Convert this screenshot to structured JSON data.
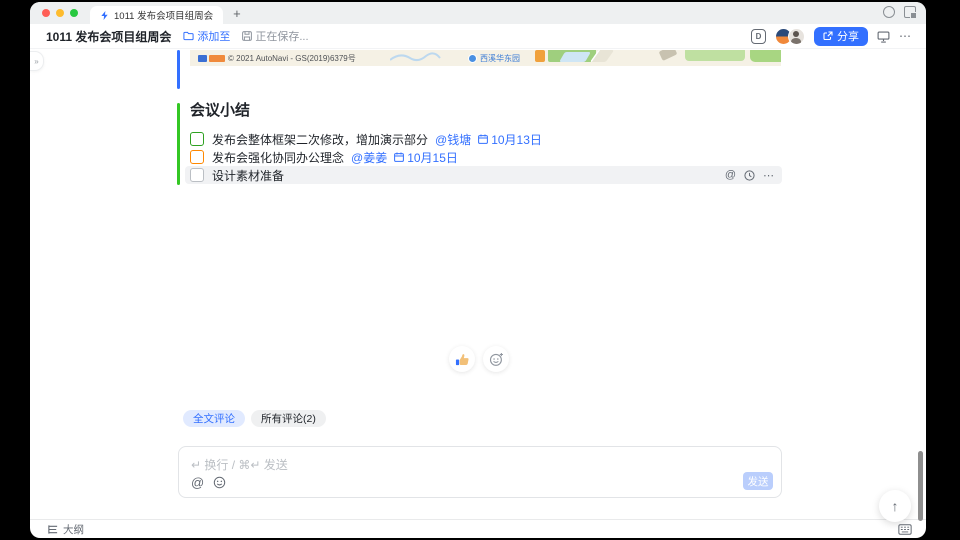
{
  "chrome": {
    "tab_title": "1011 发布会项目组周会",
    "new_tab": "+"
  },
  "header": {
    "doc_title": "1011 发布会项目组周会",
    "add_to": "添加至",
    "saving": "正在保存...",
    "share": "分享",
    "more": "⋯",
    "expand_sidebar": "»",
    "record_glyph": "D"
  },
  "map": {
    "attribution": "© 2021 AutoNavi - GS(2019)6379号",
    "place": "西溪华东园"
  },
  "doc": {
    "section_title": "会议小结",
    "todos": [
      {
        "text": "发布会整体框架二次修改，增加演示部分",
        "mention": "@钱塘",
        "due": "10月13日"
      },
      {
        "text": "发布会强化协同办公理念",
        "mention": "@姜姜",
        "due": "10月15日"
      },
      {
        "text": "设计素材准备",
        "mention": "",
        "due": ""
      }
    ],
    "row_at": "@",
    "row_more": "⋯"
  },
  "comments": {
    "tab_fulltext": "全文评论",
    "tab_all": "所有评论(2)",
    "input_placeholder": "↵ 换行 / ⌘↵ 发送",
    "at": "@",
    "send": "发送"
  },
  "footer": {
    "outline": "大纲"
  },
  "misc": {
    "back_top": "↑"
  },
  "colors": {
    "accent_blue": "#3370ff",
    "todo_green": "#2ea121",
    "todo_orange": "#ff8800",
    "comment_tab_active_bg": "#e1eaff",
    "send_disabled_bg": "#bacefc",
    "row_highlight": "#f1f2f4",
    "collab_blue": "#3370ff",
    "collab_green": "#34c724"
  }
}
